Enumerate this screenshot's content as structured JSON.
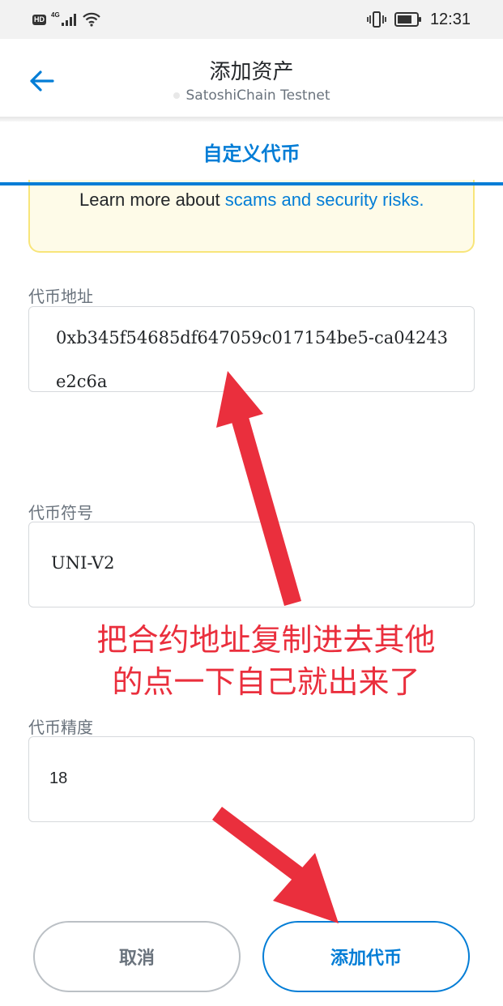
{
  "status_bar": {
    "hd_badge": "HD",
    "network_type": "4G",
    "time": "12:31",
    "icons": [
      "hd-badge",
      "signal-icon",
      "wifi-icon",
      "vibrate-icon",
      "battery-icon"
    ]
  },
  "header": {
    "back_icon": "arrow-left-icon",
    "title": "添加资产",
    "network_name": "SatoshiChain Testnet"
  },
  "tab": {
    "label": "自定义代币"
  },
  "warning": {
    "text": "Learn more about ",
    "link": "scams and security risks."
  },
  "form": {
    "address_label": "代币地址",
    "address_value": "0xb345f54685df647059c017154be5-ca04243e2c6a",
    "symbol_label": "代币符号",
    "symbol_value": "UNI-V2",
    "decimals_label": "代币精度",
    "decimals_value": "18"
  },
  "annotation": {
    "line1": "把合约地址复制进去其他",
    "line2": "的点一下自己就出来了",
    "color": "#ea2f3d"
  },
  "buttons": {
    "cancel": "取消",
    "add": "添加代币"
  },
  "colors": {
    "accent": "#037dd6",
    "warning_bg": "#fefbe8",
    "warning_border": "#f8e57a"
  }
}
